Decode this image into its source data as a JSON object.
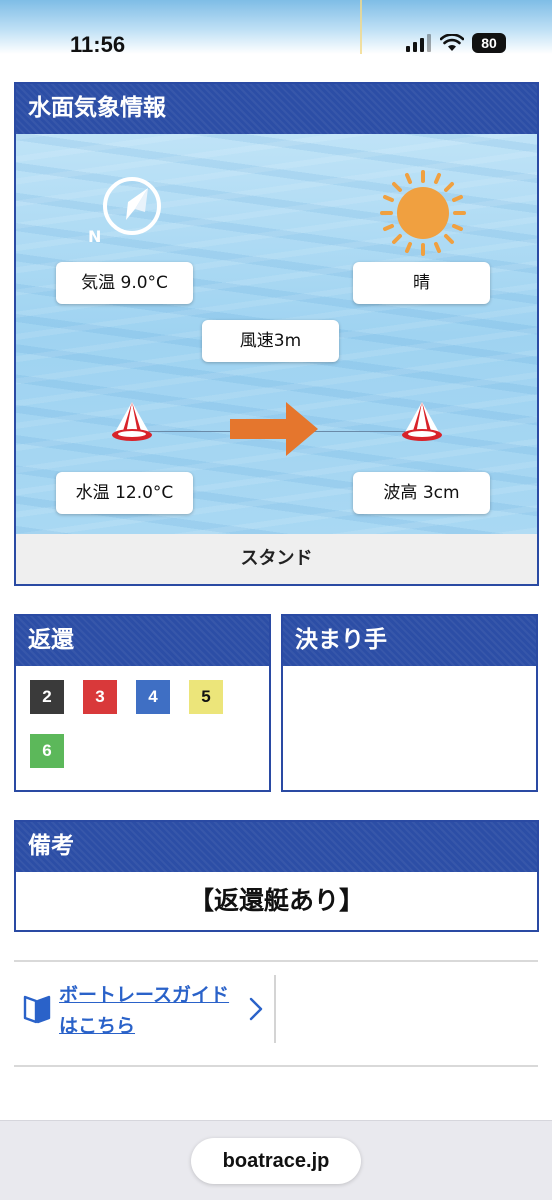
{
  "status_bar": {
    "time": "11:56",
    "battery": "80"
  },
  "weather": {
    "title": "水面気象情報",
    "compass_label": "N",
    "air_temp": "気温 9.0°C",
    "weather_label": "晴",
    "wind_speed": "風速3m",
    "water_temp": "水温 12.0°C",
    "wave_height": "波高 3cm",
    "stand_label": "スタンド",
    "colors": {
      "sun": "#f0a040",
      "wind_arrow": "#e5762d",
      "buoy": "#d8232a"
    }
  },
  "henkan": {
    "title": "返還",
    "boats": [
      {
        "number": "2",
        "bg": "#3a3a3a",
        "fg": "#ffffff"
      },
      {
        "number": "3",
        "bg": "#d9393a",
        "fg": "#ffffff"
      },
      {
        "number": "4",
        "bg": "#3f6fc4",
        "fg": "#ffffff"
      },
      {
        "number": "5",
        "bg": "#ece57a",
        "fg": "#111111"
      },
      {
        "number": "6",
        "bg": "#5cb85a",
        "fg": "#ffffff"
      }
    ]
  },
  "kimarite": {
    "title": "決まり手"
  },
  "biko": {
    "title": "備考",
    "text": "【返還艇あり】"
  },
  "guide": {
    "line1": "ボートレースガイド",
    "line2": "はこちら"
  },
  "browser": {
    "url": "boatrace.jp"
  }
}
